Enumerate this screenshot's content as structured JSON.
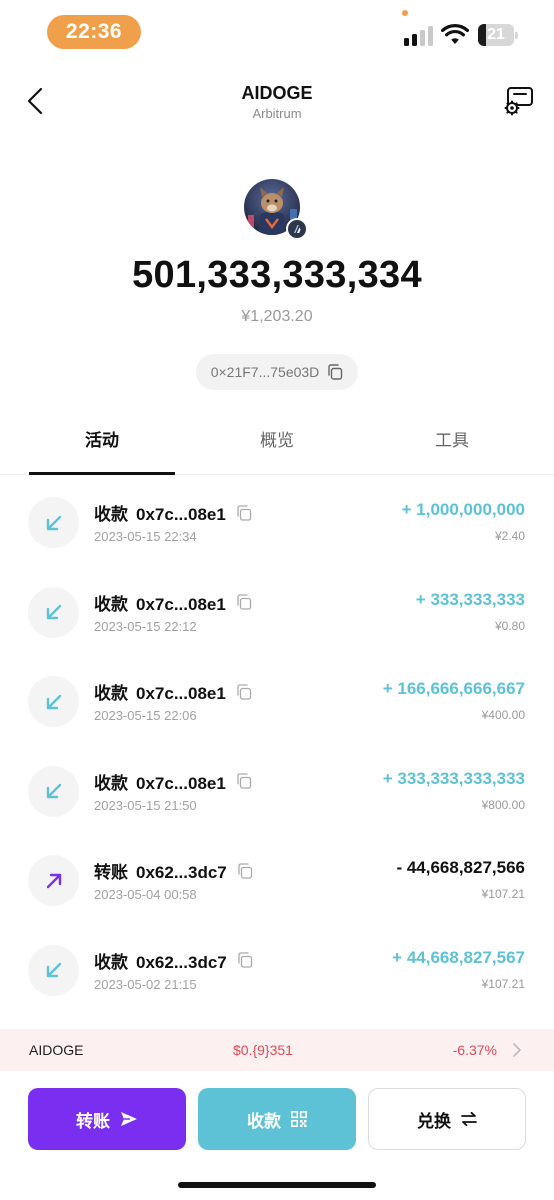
{
  "status_bar": {
    "time": "22:36",
    "battery_level": "21",
    "battery_fraction": 0.21,
    "signal_bars_active": 2,
    "signal_bars_total": 4,
    "icons": [
      "cellular-signal-icon",
      "wifi-icon",
      "battery-icon"
    ]
  },
  "header": {
    "title": "AIDOGE",
    "subtitle": "Arbitrum",
    "back_icon": "chevron-left-icon",
    "settings_icon": "token-settings-icon"
  },
  "token": {
    "balance": "501,333,333,334",
    "fiat_value": "¥1,203.20",
    "address": "0×21F7...75e03D",
    "copy_icon": "copy-icon",
    "chain_badge_icon": "arbitrum-icon"
  },
  "tabs": [
    {
      "label": "活动",
      "active": true
    },
    {
      "label": "概览",
      "active": false
    },
    {
      "label": "工具",
      "active": false
    }
  ],
  "transactions": [
    {
      "kind": "收款",
      "address": "0x7c...08e1",
      "date": "2023-05-15 22:34",
      "amount": "+ 1,000,000,000",
      "fiat": "¥2.40",
      "direction": "in"
    },
    {
      "kind": "收款",
      "address": "0x7c...08e1",
      "date": "2023-05-15 22:12",
      "amount": "+ 333,333,333",
      "fiat": "¥0.80",
      "direction": "in"
    },
    {
      "kind": "收款",
      "address": "0x7c...08e1",
      "date": "2023-05-15 22:06",
      "amount": "+ 166,666,666,667",
      "fiat": "¥400.00",
      "direction": "in"
    },
    {
      "kind": "收款",
      "address": "0x7c...08e1",
      "date": "2023-05-15 21:50",
      "amount": "+ 333,333,333,333",
      "fiat": "¥800.00",
      "direction": "in"
    },
    {
      "kind": "转账",
      "address": "0x62...3dc7",
      "date": "2023-05-04 00:58",
      "amount": "- 44,668,827,566",
      "fiat": "¥107.21",
      "direction": "out"
    },
    {
      "kind": "收款",
      "address": "0x62...3dc7",
      "date": "2023-05-02 21:15",
      "amount": "+ 44,668,827,567",
      "fiat": "¥107.21",
      "direction": "in"
    }
  ],
  "price_bar": {
    "symbol": "AIDOGE",
    "price": "$0.{9}351",
    "change": "-6.37%"
  },
  "actions": {
    "send_label": "转账",
    "receive_label": "收款",
    "swap_label": "兑换"
  },
  "colors": {
    "incoming": "#5ec2d6",
    "outgoing_icon": "#7a2ff0",
    "send_button": "#7a2ff0",
    "receive_button": "#5ec2d6",
    "price_down": "#e04b55",
    "status_pill": "#f0a04b"
  }
}
